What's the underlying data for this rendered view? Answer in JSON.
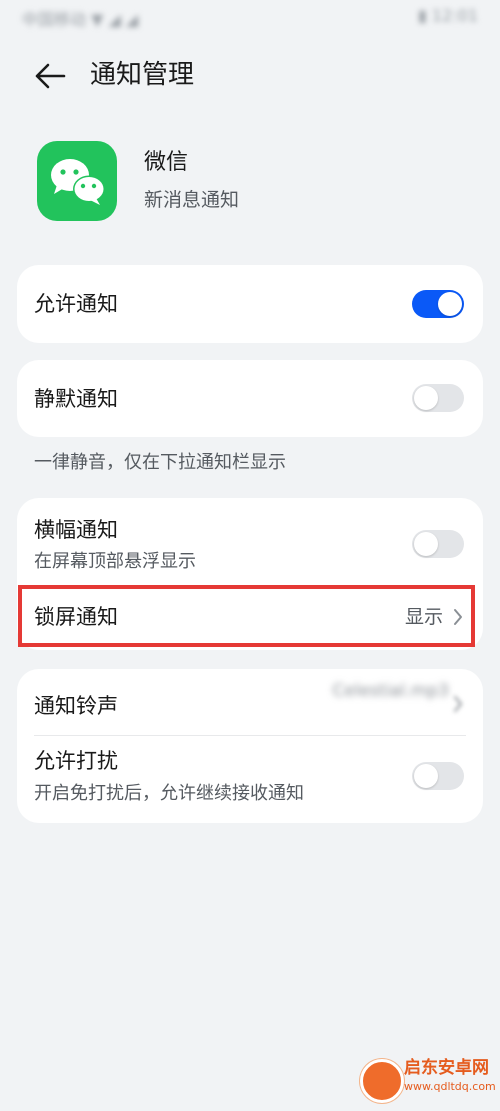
{
  "status_bar": {
    "left_text": "中国移动 ▼ ◢ ◢",
    "right_text": "▮ 12:01"
  },
  "header": {
    "title": "通知管理"
  },
  "app": {
    "name": "微信",
    "subtitle": "新消息通知",
    "icon": "wechat-icon",
    "icon_color": "#22c35c"
  },
  "settings": {
    "allow_notifications": {
      "label": "允许通知",
      "enabled": true
    },
    "silent_notifications": {
      "label": "静默通知",
      "enabled": false
    },
    "silent_note": "一律静音，仅在下拉通知栏显示",
    "banner_notifications": {
      "label": "横幅通知",
      "subtitle": "在屏幕顶部悬浮显示",
      "enabled": false
    },
    "lock_screen_notifications": {
      "label": "锁屏通知",
      "value": "显示"
    },
    "notification_ringtone": {
      "label": "通知铃声",
      "value": "Celestial.mp3"
    },
    "allow_interruptions": {
      "label": "允许打扰",
      "subtitle": "开启免打扰后，允许继续接收通知",
      "enabled": false
    }
  },
  "colors": {
    "accent": "#0a59f7",
    "highlight": "#e53935",
    "background": "#f1f3f5"
  },
  "watermark": {
    "title": "启东安卓网",
    "url": "www.qdltdq.com"
  }
}
